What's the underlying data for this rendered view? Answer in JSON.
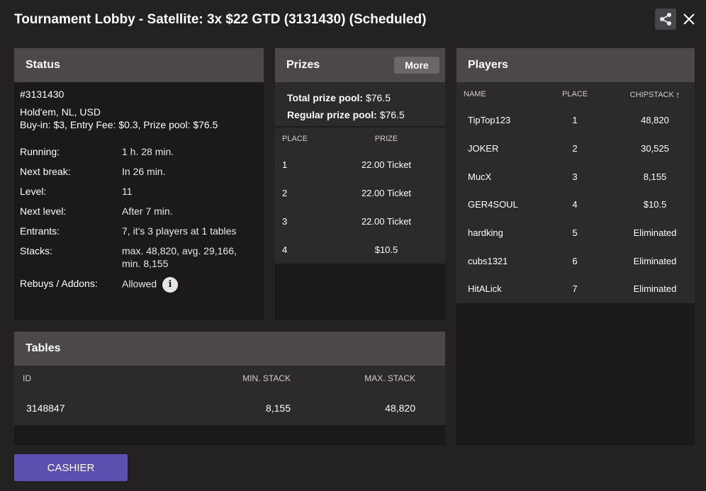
{
  "window": {
    "title": "Tournament Lobby - Satellite: 3x $22 GTD (3131430) (Scheduled)",
    "share_icon": "share-icon",
    "close_icon": "close-icon"
  },
  "status": {
    "header": "Status",
    "id": "#3131430",
    "game": "Hold'em, NL, USD",
    "buyin": "Buy-in: $3, Entry Fee: $0.3, Prize pool: $76.5",
    "rows": [
      {
        "label": "Running:",
        "value": "1 h. 28 min."
      },
      {
        "label": "Next break:",
        "value": "In 26 min."
      },
      {
        "label": "Level:",
        "value": "11"
      },
      {
        "label": "Next level:",
        "value": "After 7 min."
      },
      {
        "label": "Entrants:",
        "value": "7, it's 3 players at 1 tables"
      },
      {
        "label": "Stacks:",
        "value": "max. 48,820, avg. 29,166, min. 8,155"
      },
      {
        "label": "Rebuys / Addons:",
        "value": "Allowed"
      }
    ],
    "info_icon_glyph": "i"
  },
  "prizes": {
    "header": "Prizes",
    "more_label": "More",
    "total_label": "Total prize pool:",
    "total_value": "$76.5",
    "regular_label": "Regular prize pool:",
    "regular_value": "$76.5",
    "columns": {
      "place": "PLACE",
      "prize": "PRIZE"
    },
    "rows": [
      {
        "place": "1",
        "prize": "22.00 Ticket"
      },
      {
        "place": "2",
        "prize": "22.00 Ticket"
      },
      {
        "place": "3",
        "prize": "22.00 Ticket"
      },
      {
        "place": "4",
        "prize": "$10.5"
      }
    ]
  },
  "players": {
    "header": "Players",
    "columns": {
      "name": "NAME",
      "place": "PLACE",
      "chipstack": "CHIPSTACK"
    },
    "sort_icon": "sort-ascending-icon",
    "rows": [
      {
        "name": "TipTop123",
        "place": "1",
        "chips": "48,820"
      },
      {
        "name": "JOKER",
        "place": "2",
        "chips": "30,525"
      },
      {
        "name": "MucX",
        "place": "3",
        "chips": "8,155"
      },
      {
        "name": "GER4SOUL",
        "place": "4",
        "chips": "$10.5"
      },
      {
        "name": "hardking",
        "place": "5",
        "chips": "Eliminated"
      },
      {
        "name": "cubs1321",
        "place": "6",
        "chips": "Eliminated"
      },
      {
        "name": "HitALick",
        "place": "7",
        "chips": "Eliminated"
      }
    ]
  },
  "tables": {
    "header": "Tables",
    "columns": {
      "id": "ID",
      "min": "MIN. STACK",
      "max": "MAX. STACK"
    },
    "rows": [
      {
        "id": "3148847",
        "min": "8,155",
        "max": "48,820"
      }
    ]
  },
  "footer": {
    "cashier_label": "CASHIER"
  },
  "colors": {
    "background": "#232122",
    "panel_header": "#4c4849",
    "panel_body": "#1b191a",
    "table_bg": "#2c2a2b",
    "cashier_button": "#5b4fb0"
  }
}
